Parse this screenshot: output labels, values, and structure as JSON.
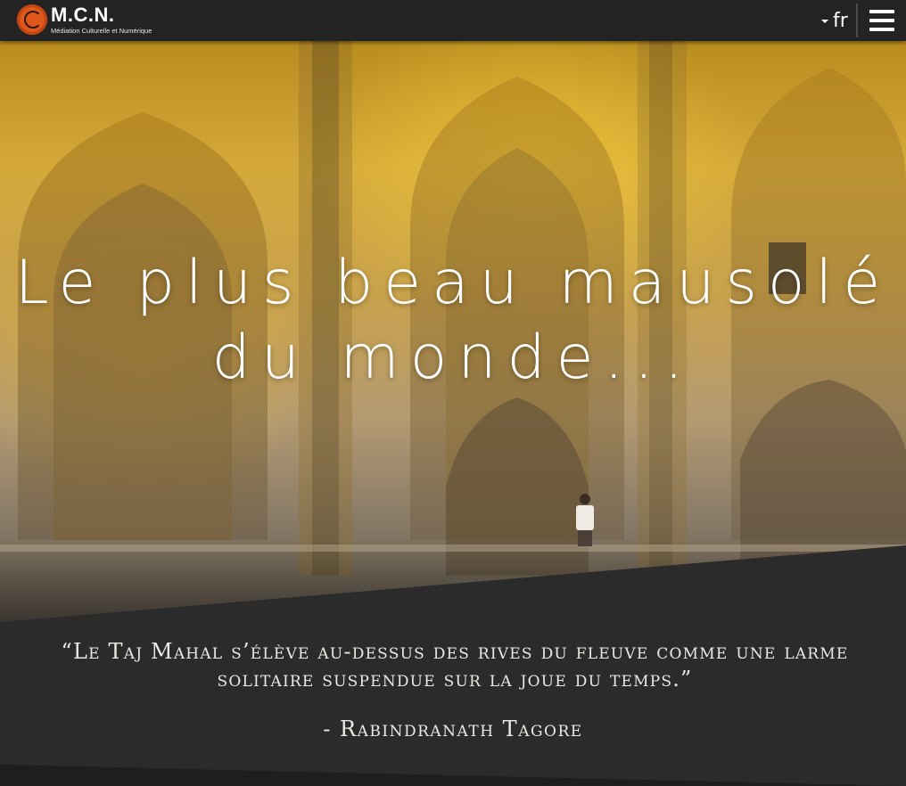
{
  "header": {
    "logo_title": "M.C.N.",
    "logo_subtitle": "Médiation Culturelle et Numérique",
    "language": "fr",
    "icons": {
      "logo": "circle-logo-icon",
      "caret": "caret-down-icon",
      "menu": "hamburger-menu-icon"
    }
  },
  "hero": {
    "title_line1": "Le plus beau mausolé",
    "title_line2": "du monde..."
  },
  "quote": {
    "text": "“Le Taj Mahal s’élève au-dessus des rives du fleuve comme une larme solitaire suspendue sur la joue du temps.”",
    "author": "- Rabindranath Tagore"
  },
  "colors": {
    "accent": "#e0571b",
    "dark_band": "#2b2b2c",
    "header_bg": "#232323"
  }
}
